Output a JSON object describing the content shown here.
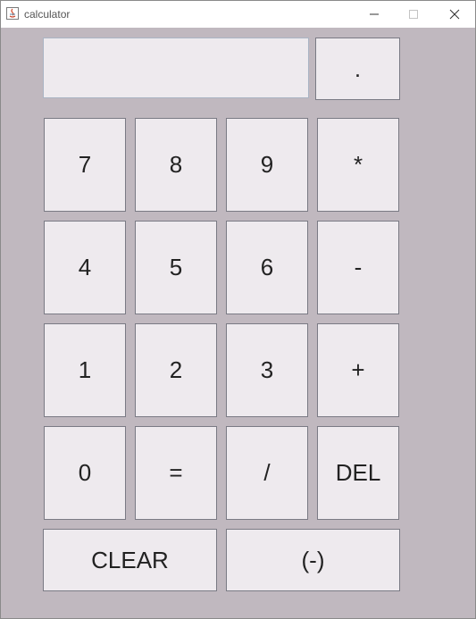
{
  "window": {
    "title": "calculator",
    "controls": {
      "minimize": "minimize-icon",
      "maximize": "maximize-icon",
      "close": "close-icon"
    }
  },
  "display": {
    "value": ""
  },
  "keys": {
    "dot": ".",
    "row1": [
      "7",
      "8",
      "9",
      "*"
    ],
    "row2": [
      "4",
      "5",
      "6",
      "-"
    ],
    "row3": [
      "1",
      "2",
      "3",
      "+"
    ],
    "row4": [
      "0",
      "=",
      "/",
      "DEL"
    ],
    "clear": "CLEAR",
    "negate": "(-)"
  },
  "colors": {
    "background": "#c0b8bf",
    "button": "#eeeaee",
    "border": "#7a7a84"
  }
}
